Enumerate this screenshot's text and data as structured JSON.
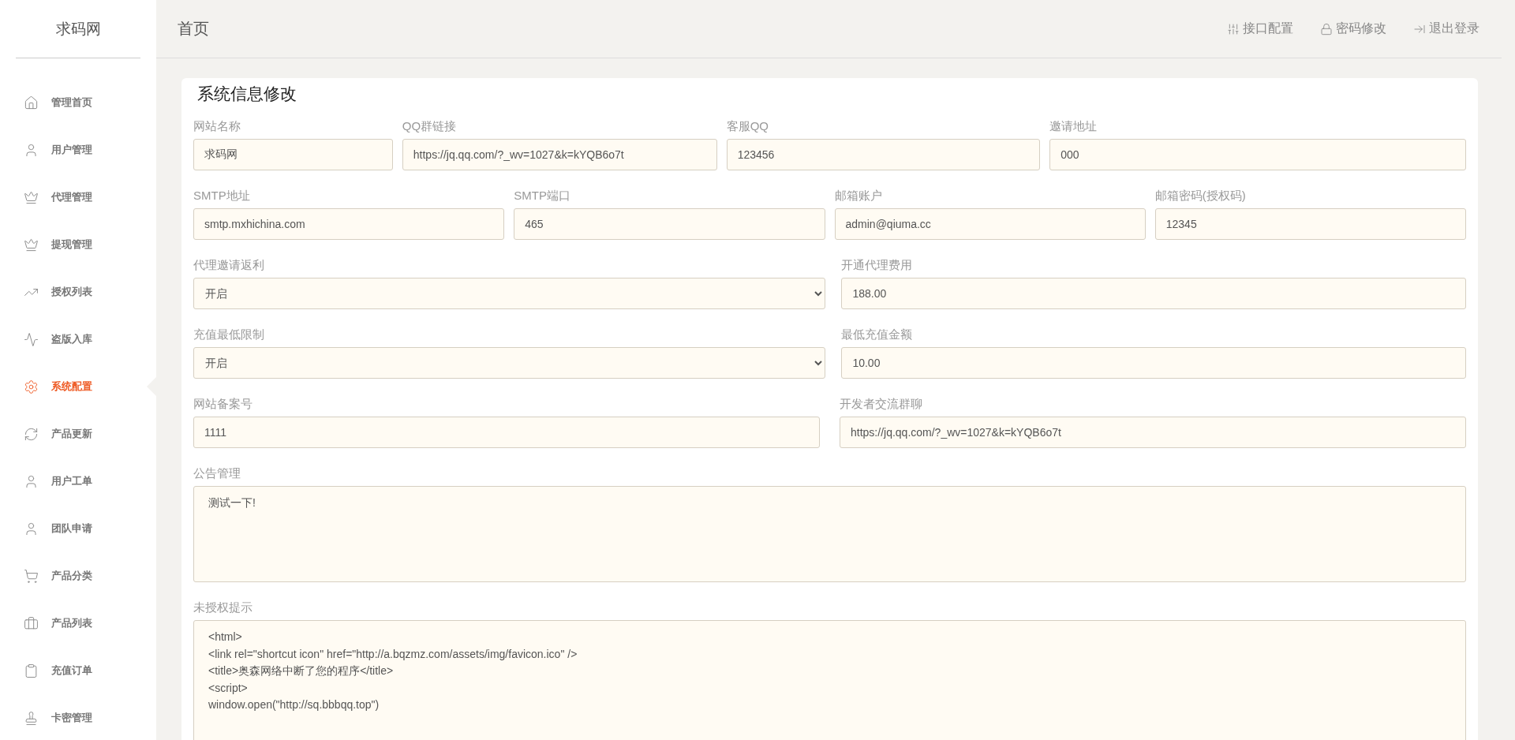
{
  "sidebar": {
    "brand": "求码网",
    "items": [
      {
        "label": "管理首页",
        "selected": false
      },
      {
        "label": "用户管理",
        "selected": false
      },
      {
        "label": "代理管理",
        "selected": false
      },
      {
        "label": "提现管理",
        "selected": false
      },
      {
        "label": "授权列表",
        "selected": false
      },
      {
        "label": "盗版入库",
        "selected": false
      },
      {
        "label": "系统配置",
        "selected": true
      },
      {
        "label": "产品更新",
        "selected": false
      },
      {
        "label": "用户工单",
        "selected": false
      },
      {
        "label": "团队申请",
        "selected": false
      },
      {
        "label": "产品分类",
        "selected": false
      },
      {
        "label": "产品列表",
        "selected": false
      },
      {
        "label": "充值订单",
        "selected": false
      },
      {
        "label": "卡密管理",
        "selected": false
      }
    ]
  },
  "header": {
    "title": "首页",
    "links": [
      "接口配置",
      "密码修改",
      "退出登录"
    ]
  },
  "form": {
    "title": "系统信息修改",
    "field_groups": [
      {
        "fields": [
          {
            "kind": "text",
            "label": "网站名称",
            "value": "求码网"
          },
          {
            "kind": "text",
            "label": "QQ群链接",
            "value": "https://jq.qq.com/?_wv=1027&k=kYQB6o7t"
          },
          {
            "kind": "text",
            "label": "客服QQ",
            "value": "123456"
          },
          {
            "kind": "text",
            "label": "邀请地址",
            "value": "000"
          }
        ]
      },
      {
        "fields": [
          {
            "kind": "text",
            "label": "SMTP地址",
            "value": "smtp.mxhichina.com"
          },
          {
            "kind": "text",
            "label": "SMTP端口",
            "value": "465"
          },
          {
            "kind": "text",
            "label": "邮箱账户",
            "value": "admin@qiuma.cc"
          },
          {
            "kind": "text",
            "label": "邮箱密码(授权码)",
            "value": "12345"
          }
        ]
      },
      {
        "fields": [
          {
            "kind": "select",
            "label": "代理邀请返利",
            "value": "开启"
          },
          {
            "kind": "text",
            "label": "开通代理费用",
            "value": "188.00"
          }
        ]
      },
      {
        "fields": [
          {
            "kind": "select",
            "label": "充值最低限制",
            "value": "开启"
          },
          {
            "kind": "text",
            "label": "最低充值金额",
            "value": "10.00"
          }
        ]
      },
      {
        "fields": [
          {
            "kind": "text",
            "label": "网站备案号",
            "value": "1111"
          },
          {
            "kind": "text",
            "label": "开发者交流群聊",
            "value": "https://jq.qq.com/?_wv=1027&k=kYQB6o7t"
          }
        ]
      },
      {
        "fields": [
          {
            "kind": "textarea",
            "label": "公告管理",
            "value": "测试一下!"
          }
        ]
      },
      {
        "fields": [
          {
            "kind": "textarea",
            "label": "未授权提示",
            "value": "<html>\n<link rel=\"shortcut icon\" href=\"http://a.bqzmz.com/assets/img/favicon.ico\" />\n<title>奥森网络中断了您的程序</title>\n<script>\nwindow.open(\"http://sq.bbbqq.top\")"
          }
        ]
      }
    ]
  }
}
